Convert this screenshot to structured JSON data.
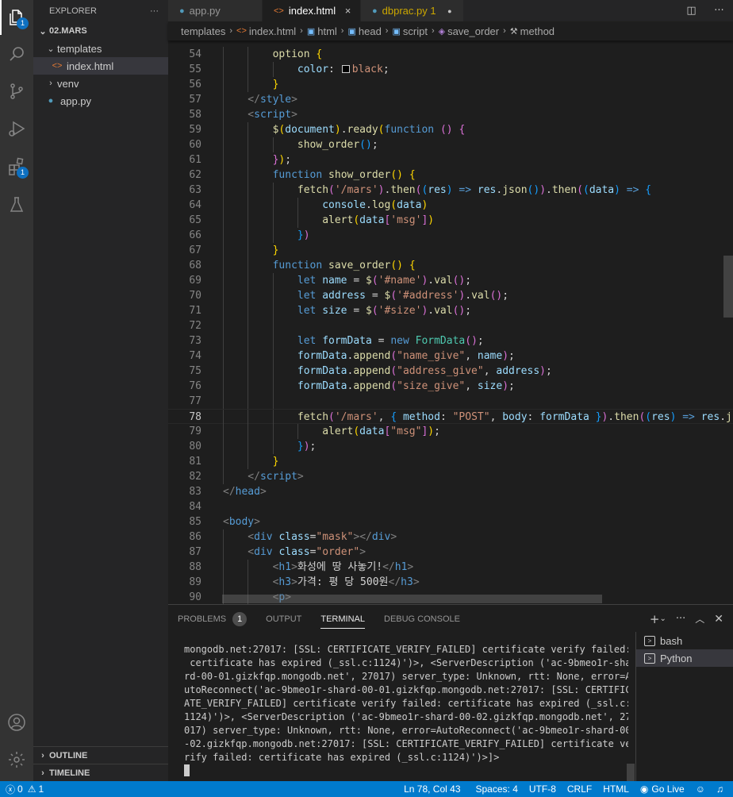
{
  "activity_bar": {
    "explorer_badge": "1",
    "extensions_badge": "1"
  },
  "sidebar": {
    "header": "EXPLORER",
    "more": "···",
    "tree": {
      "root": "02.MARS",
      "templates": "templates",
      "index": "index.html",
      "venv": "venv",
      "app": "app.py"
    },
    "outline": "OUTLINE",
    "timeline": "TIMELINE"
  },
  "tabs": [
    {
      "label": "app.py"
    },
    {
      "label": "index.html",
      "close": "×"
    },
    {
      "label": "dbprac.py 1"
    }
  ],
  "breadcrumb": [
    "templates",
    "index.html",
    "html",
    "head",
    "script",
    "save_order",
    "method"
  ],
  "editor": {
    "lines": [
      {
        "n": "54",
        "i": 2,
        "tok": [
          [
            "option",
            "fn"
          ],
          [
            " ",
            "tx"
          ],
          [
            "{",
            "b1"
          ]
        ]
      },
      {
        "n": "55",
        "i": 3,
        "tok": [
          [
            "color",
            "at"
          ],
          [
            ": ",
            "tx"
          ],
          [
            "",
            "sw"
          ],
          [
            "black",
            "st"
          ],
          [
            ";",
            "tx"
          ]
        ]
      },
      {
        "n": "56",
        "i": 2,
        "tok": [
          [
            "}",
            "b1"
          ]
        ]
      },
      {
        "n": "57",
        "i": 1,
        "tok": [
          [
            "</",
            "tg"
          ],
          [
            "style",
            "tn"
          ],
          [
            ">",
            "tg"
          ]
        ]
      },
      {
        "n": "58",
        "i": 1,
        "tok": [
          [
            "<",
            "tg"
          ],
          [
            "script",
            "tn"
          ],
          [
            ">",
            "tg"
          ]
        ]
      },
      {
        "n": "59",
        "i": 2,
        "tok": [
          [
            "$",
            "fn"
          ],
          [
            "(",
            "b1"
          ],
          [
            "document",
            "vr"
          ],
          [
            ")",
            "b1"
          ],
          [
            ".",
            "tx"
          ],
          [
            "ready",
            "fn"
          ],
          [
            "(",
            "b1"
          ],
          [
            "function",
            "kw"
          ],
          [
            " ",
            "tx"
          ],
          [
            "()",
            "b2"
          ],
          [
            " ",
            "tx"
          ],
          [
            "{",
            "b2"
          ]
        ]
      },
      {
        "n": "60",
        "i": 3,
        "tok": [
          [
            "show_order",
            "fn"
          ],
          [
            "()",
            "b3"
          ],
          [
            ";",
            "tx"
          ]
        ]
      },
      {
        "n": "61",
        "i": 2,
        "tok": [
          [
            "}",
            "b2"
          ],
          [
            ")",
            "b1"
          ],
          [
            ";",
            "tx"
          ]
        ]
      },
      {
        "n": "62",
        "i": 2,
        "tok": [
          [
            "function",
            "kw"
          ],
          [
            " ",
            "tx"
          ],
          [
            "show_order",
            "fn"
          ],
          [
            "()",
            "b1"
          ],
          [
            " ",
            "tx"
          ],
          [
            "{",
            "b1"
          ]
        ]
      },
      {
        "n": "63",
        "i": 3,
        "tok": [
          [
            "fetch",
            "fn"
          ],
          [
            "(",
            "b2"
          ],
          [
            "'/mars'",
            "st"
          ],
          [
            ")",
            "b2"
          ],
          [
            ".",
            "tx"
          ],
          [
            "then",
            "fn"
          ],
          [
            "(",
            "b2"
          ],
          [
            "(",
            "b3"
          ],
          [
            "res",
            "vr"
          ],
          [
            ")",
            "b3"
          ],
          [
            " ",
            "tx"
          ],
          [
            "=>",
            "kw"
          ],
          [
            " ",
            "tx"
          ],
          [
            "res",
            "vr"
          ],
          [
            ".",
            "tx"
          ],
          [
            "json",
            "fn"
          ],
          [
            "()",
            "b3"
          ],
          [
            ")",
            "b2"
          ],
          [
            ".",
            "tx"
          ],
          [
            "then",
            "fn"
          ],
          [
            "(",
            "b2"
          ],
          [
            "(",
            "b3"
          ],
          [
            "data",
            "vr"
          ],
          [
            ")",
            "b3"
          ],
          [
            " ",
            "tx"
          ],
          [
            "=>",
            "kw"
          ],
          [
            " ",
            "tx"
          ],
          [
            "{",
            "b3"
          ]
        ]
      },
      {
        "n": "64",
        "i": 4,
        "tok": [
          [
            "console",
            "vr"
          ],
          [
            ".",
            "tx"
          ],
          [
            "log",
            "fn"
          ],
          [
            "(",
            "b1"
          ],
          [
            "data",
            "vr"
          ],
          [
            ")",
            "b1"
          ]
        ]
      },
      {
        "n": "65",
        "i": 4,
        "tok": [
          [
            "alert",
            "fn"
          ],
          [
            "(",
            "b1"
          ],
          [
            "data",
            "vr"
          ],
          [
            "[",
            "b2"
          ],
          [
            "'msg'",
            "st"
          ],
          [
            "]",
            "b2"
          ],
          [
            ")",
            "b1"
          ]
        ]
      },
      {
        "n": "66",
        "i": 3,
        "tok": [
          [
            "}",
            "b3"
          ],
          [
            ")",
            "b2"
          ]
        ]
      },
      {
        "n": "67",
        "i": 2,
        "tok": [
          [
            "}",
            "b1"
          ]
        ]
      },
      {
        "n": "68",
        "i": 2,
        "tok": [
          [
            "function",
            "kw"
          ],
          [
            " ",
            "tx"
          ],
          [
            "save_order",
            "fn"
          ],
          [
            "()",
            "b1"
          ],
          [
            " ",
            "tx"
          ],
          [
            "{",
            "b1"
          ]
        ]
      },
      {
        "n": "69",
        "i": 3,
        "tok": [
          [
            "let",
            "kw"
          ],
          [
            " ",
            "tx"
          ],
          [
            "name",
            "vr"
          ],
          [
            " = ",
            "tx"
          ],
          [
            "$",
            "fn"
          ],
          [
            "(",
            "b2"
          ],
          [
            "'#name'",
            "st"
          ],
          [
            ")",
            "b2"
          ],
          [
            ".",
            "tx"
          ],
          [
            "val",
            "fn"
          ],
          [
            "()",
            "b2"
          ],
          [
            ";",
            "tx"
          ]
        ]
      },
      {
        "n": "70",
        "i": 3,
        "tok": [
          [
            "let",
            "kw"
          ],
          [
            " ",
            "tx"
          ],
          [
            "address",
            "vr"
          ],
          [
            " = ",
            "tx"
          ],
          [
            "$",
            "fn"
          ],
          [
            "(",
            "b2"
          ],
          [
            "'#address'",
            "st"
          ],
          [
            ")",
            "b2"
          ],
          [
            ".",
            "tx"
          ],
          [
            "val",
            "fn"
          ],
          [
            "()",
            "b2"
          ],
          [
            ";",
            "tx"
          ]
        ]
      },
      {
        "n": "71",
        "i": 3,
        "tok": [
          [
            "let",
            "kw"
          ],
          [
            " ",
            "tx"
          ],
          [
            "size",
            "vr"
          ],
          [
            " = ",
            "tx"
          ],
          [
            "$",
            "fn"
          ],
          [
            "(",
            "b2"
          ],
          [
            "'#size'",
            "st"
          ],
          [
            ")",
            "b2"
          ],
          [
            ".",
            "tx"
          ],
          [
            "val",
            "fn"
          ],
          [
            "()",
            "b2"
          ],
          [
            ";",
            "tx"
          ]
        ]
      },
      {
        "n": "72",
        "i": 3,
        "tok": []
      },
      {
        "n": "73",
        "i": 3,
        "tok": [
          [
            "let",
            "kw"
          ],
          [
            " ",
            "tx"
          ],
          [
            "formData",
            "vr"
          ],
          [
            " = ",
            "tx"
          ],
          [
            "new",
            "kw"
          ],
          [
            " ",
            "tx"
          ],
          [
            "FormData",
            "cl"
          ],
          [
            "()",
            "b2"
          ],
          [
            ";",
            "tx"
          ]
        ]
      },
      {
        "n": "74",
        "i": 3,
        "tok": [
          [
            "formData",
            "vr"
          ],
          [
            ".",
            "tx"
          ],
          [
            "append",
            "fn"
          ],
          [
            "(",
            "b2"
          ],
          [
            "\"name_give\"",
            "st"
          ],
          [
            ", ",
            "tx"
          ],
          [
            "name",
            "vr"
          ],
          [
            ")",
            "b2"
          ],
          [
            ";",
            "tx"
          ]
        ]
      },
      {
        "n": "75",
        "i": 3,
        "tok": [
          [
            "formData",
            "vr"
          ],
          [
            ".",
            "tx"
          ],
          [
            "append",
            "fn"
          ],
          [
            "(",
            "b2"
          ],
          [
            "\"address_give\"",
            "st"
          ],
          [
            ", ",
            "tx"
          ],
          [
            "address",
            "vr"
          ],
          [
            ")",
            "b2"
          ],
          [
            ";",
            "tx"
          ]
        ]
      },
      {
        "n": "76",
        "i": 3,
        "tok": [
          [
            "formData",
            "vr"
          ],
          [
            ".",
            "tx"
          ],
          [
            "append",
            "fn"
          ],
          [
            "(",
            "b2"
          ],
          [
            "\"size_give\"",
            "st"
          ],
          [
            ", ",
            "tx"
          ],
          [
            "size",
            "vr"
          ],
          [
            ")",
            "b2"
          ],
          [
            ";",
            "tx"
          ]
        ]
      },
      {
        "n": "77",
        "i": 3,
        "tok": []
      },
      {
        "n": "78",
        "i": 3,
        "cur": true,
        "tok": [
          [
            "fetch",
            "fn"
          ],
          [
            "(",
            "b2"
          ],
          [
            "'/mars'",
            "st"
          ],
          [
            ", ",
            "tx"
          ],
          [
            "{",
            "b3"
          ],
          [
            " ",
            "tx"
          ],
          [
            "method",
            "at"
          ],
          [
            ": ",
            "tx"
          ],
          [
            "\"POST\"",
            "st"
          ],
          [
            ", ",
            "tx"
          ],
          [
            "body",
            "at"
          ],
          [
            ": ",
            "tx"
          ],
          [
            "formData",
            "vr"
          ],
          [
            " ",
            "tx"
          ],
          [
            "}",
            "b3"
          ],
          [
            ")",
            "b2"
          ],
          [
            ".",
            "tx"
          ],
          [
            "then",
            "fn"
          ],
          [
            "(",
            "b2"
          ],
          [
            "(",
            "b3"
          ],
          [
            "res",
            "vr"
          ],
          [
            ")",
            "b3"
          ],
          [
            " ",
            "tx"
          ],
          [
            "=>",
            "kw"
          ],
          [
            " ",
            "tx"
          ],
          [
            "res",
            "vr"
          ],
          [
            ".",
            "tx"
          ],
          [
            "json",
            "fn"
          ]
        ]
      },
      {
        "n": "79",
        "i": 4,
        "tok": [
          [
            "alert",
            "fn"
          ],
          [
            "(",
            "b1"
          ],
          [
            "data",
            "vr"
          ],
          [
            "[",
            "b2"
          ],
          [
            "\"msg\"",
            "st"
          ],
          [
            "]",
            "b2"
          ],
          [
            ")",
            "b1"
          ],
          [
            ";",
            "tx"
          ]
        ]
      },
      {
        "n": "80",
        "i": 3,
        "tok": [
          [
            "}",
            "b3"
          ],
          [
            ")",
            "b2"
          ],
          [
            ";",
            "tx"
          ]
        ]
      },
      {
        "n": "81",
        "i": 2,
        "tok": [
          [
            "}",
            "b1"
          ]
        ]
      },
      {
        "n": "82",
        "i": 1,
        "tok": [
          [
            "</",
            "tg"
          ],
          [
            "script",
            "tn"
          ],
          [
            ">",
            "tg"
          ]
        ]
      },
      {
        "n": "83",
        "i": 0,
        "tok": [
          [
            "</",
            "tg"
          ],
          [
            "head",
            "tn"
          ],
          [
            ">",
            "tg"
          ]
        ]
      },
      {
        "n": "84",
        "i": 0,
        "tok": []
      },
      {
        "n": "85",
        "i": 0,
        "tok": [
          [
            "<",
            "tg"
          ],
          [
            "body",
            "tn"
          ],
          [
            ">",
            "tg"
          ]
        ]
      },
      {
        "n": "86",
        "i": 1,
        "tok": [
          [
            "<",
            "tg"
          ],
          [
            "div",
            "tn"
          ],
          [
            " ",
            "tx"
          ],
          [
            "class",
            "at"
          ],
          [
            "=",
            "tx"
          ],
          [
            "\"mask\"",
            "st"
          ],
          [
            "></",
            "tg"
          ],
          [
            "div",
            "tn"
          ],
          [
            ">",
            "tg"
          ]
        ]
      },
      {
        "n": "87",
        "i": 1,
        "tok": [
          [
            "<",
            "tg"
          ],
          [
            "div",
            "tn"
          ],
          [
            " ",
            "tx"
          ],
          [
            "class",
            "at"
          ],
          [
            "=",
            "tx"
          ],
          [
            "\"order\"",
            "st"
          ],
          [
            ">",
            "tg"
          ]
        ]
      },
      {
        "n": "88",
        "i": 2,
        "tok": [
          [
            "<",
            "tg"
          ],
          [
            "h1",
            "tn"
          ],
          [
            ">",
            "tg"
          ],
          [
            "화성에 땅 사놓기!",
            "tx"
          ],
          [
            "</",
            "tg"
          ],
          [
            "h1",
            "tn"
          ],
          [
            ">",
            "tg"
          ]
        ]
      },
      {
        "n": "89",
        "i": 2,
        "tok": [
          [
            "<",
            "tg"
          ],
          [
            "h3",
            "tn"
          ],
          [
            ">",
            "tg"
          ],
          [
            "가격: 평 당 500원",
            "tx"
          ],
          [
            "</",
            "tg"
          ],
          [
            "h3",
            "tn"
          ],
          [
            ">",
            "tg"
          ]
        ]
      },
      {
        "n": "90",
        "i": 2,
        "tok": [
          [
            "<",
            "tg"
          ],
          [
            "p",
            "tn"
          ],
          [
            ">",
            "tg"
          ]
        ]
      }
    ]
  },
  "panel": {
    "tabs": {
      "problems": "PROBLEMS",
      "problems_count": "1",
      "output": "OUTPUT",
      "terminal": "TERMINAL",
      "debug": "DEBUG CONSOLE"
    },
    "terminal_lines": [
      "mongodb.net:27017: [SSL: CERTIFICATE_VERIFY_FAILED] certificate verify failed:",
      " certificate has expired (_ssl.c:1124)')>, <ServerDescription ('ac-9bmeo1r-sha",
      "rd-00-01.gizkfqp.mongodb.net', 27017) server_type: Unknown, rtt: None, error=A",
      "utoReconnect('ac-9bmeo1r-shard-00-01.gizkfqp.mongodb.net:27017: [SSL: CERTIFIC",
      "ATE_VERIFY_FAILED] certificate verify failed: certificate has expired (_ssl.c:",
      "1124)')>, <ServerDescription ('ac-9bmeo1r-shard-00-02.gizkfqp.mongodb.net', 27",
      "017) server_type: Unknown, rtt: None, error=AutoReconnect('ac-9bmeo1r-shard-00",
      "-02.gizkfqp.mongodb.net:27017: [SSL: CERTIFICATE_VERIFY_FAILED] certificate ve",
      "rify failed: certificate has expired (_ssl.c:1124)')>]>"
    ],
    "terminals": [
      "bash",
      "Python"
    ]
  },
  "status": {
    "errors": "0",
    "warnings": "1",
    "position": "Ln 78, Col 43",
    "spaces": "Spaces: 4",
    "encoding": "UTF-8",
    "eol": "CRLF",
    "language": "HTML",
    "golive": "Go Live"
  },
  "colors": {
    "accent": "#007acc",
    "badge": "#0e70c0"
  }
}
